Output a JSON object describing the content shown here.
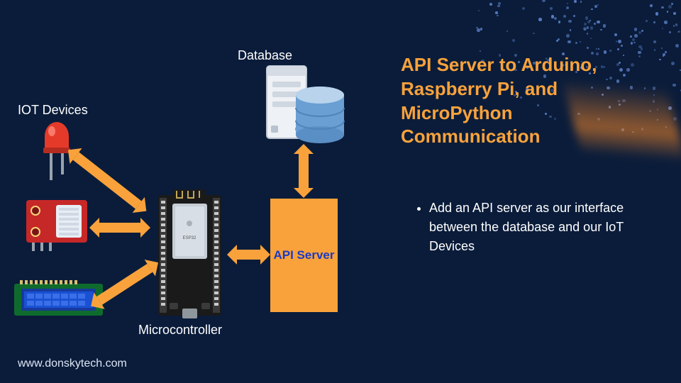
{
  "title": "API Server to Arduino, Raspberry Pi, and MicroPython Communication",
  "bullet": "Add an API server as our interface between the database and our IoT Devices",
  "labels": {
    "iot": "IOT Devices",
    "database": "Database",
    "microcontroller": "Microcontroller",
    "api_server": "API Server"
  },
  "footer": "www.donskytech.com",
  "colors": {
    "bg": "#0a1c3a",
    "accent": "#f9a23b",
    "api_text": "#1d3ac4"
  },
  "components": {
    "led": "red-led-icon",
    "dht": "dht-sensor-icon",
    "lcd": "lcd-display-icon",
    "mcu": "esp32-microcontroller-icon",
    "server": "server-tower-icon",
    "db": "database-cylinder-icon"
  }
}
